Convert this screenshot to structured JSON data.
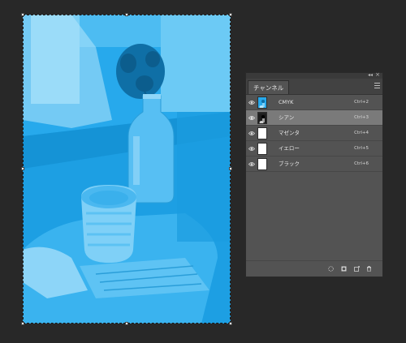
{
  "panel": {
    "tab_label": "チャンネル",
    "icons": {
      "collapse": "collapse-double-arrow-icon",
      "close": "close-icon",
      "menu": "panel-menu-icon"
    },
    "channels": [
      {
        "name": "CMYK",
        "shortcut": "Ctrl+2",
        "visible": true,
        "selected": false
      },
      {
        "name": "シアン",
        "shortcut": "Ctrl+3",
        "visible": true,
        "selected": true
      },
      {
        "name": "マゼンタ",
        "shortcut": "Ctrl+4",
        "visible": true,
        "selected": false
      },
      {
        "name": "イエロー",
        "shortcut": "Ctrl+5",
        "visible": true,
        "selected": false
      },
      {
        "name": "ブラック",
        "shortcut": "Ctrl+6",
        "visible": true,
        "selected": false
      }
    ],
    "footer_icons": [
      "load-channel-as-selection-icon",
      "save-selection-as-channel-icon",
      "new-channel-icon",
      "delete-channel-icon"
    ]
  },
  "colors": {
    "workspace": "#282828",
    "canvas_cyan": "#27a9ec",
    "panel_bg": "#535353",
    "selected_row": "#7a7a7a"
  }
}
